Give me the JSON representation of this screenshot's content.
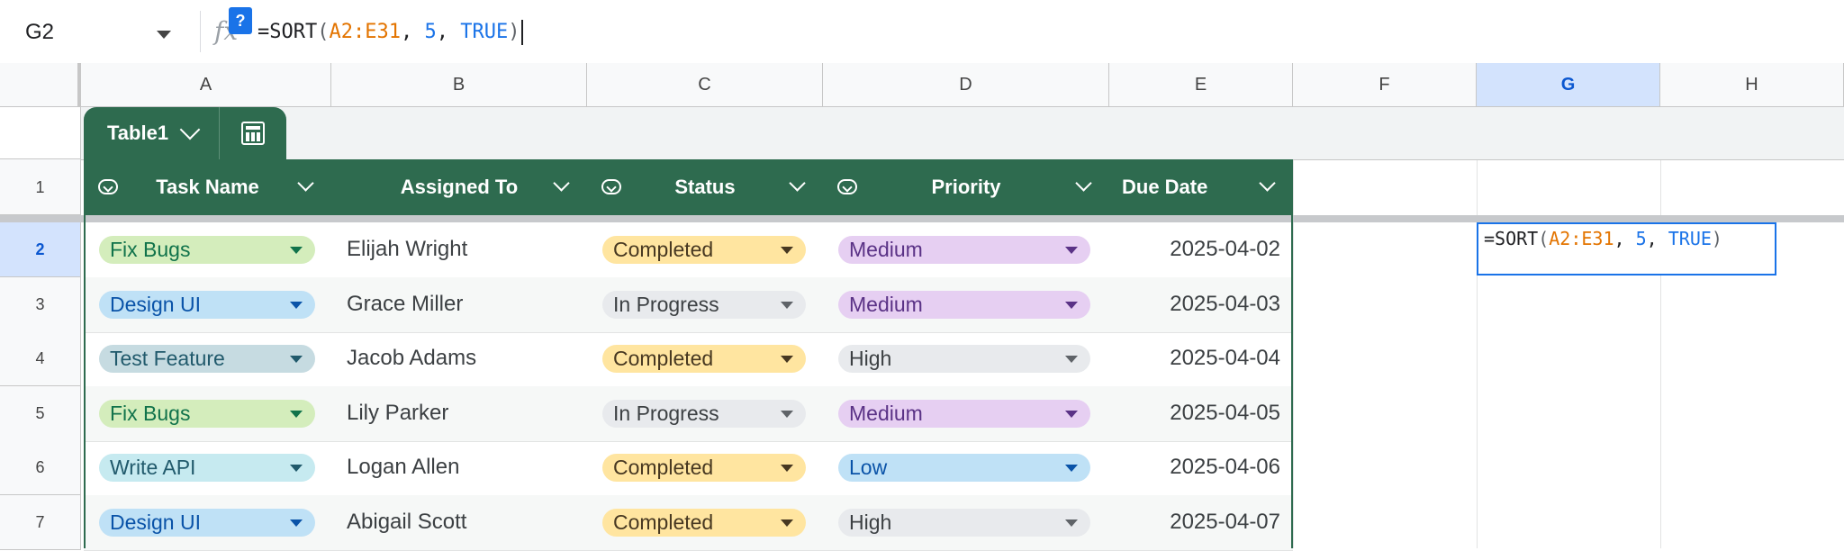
{
  "formula_bar": {
    "name_box": "G2",
    "help": "?",
    "formula": {
      "eq": "=SORT",
      "open": "(",
      "range": "A2:E31",
      "sep1": ", ",
      "num": "5",
      "sep2": ", ",
      "bool": "TRUE",
      "close": ")"
    }
  },
  "columns": [
    "A",
    "B",
    "C",
    "D",
    "E",
    "F",
    "G",
    "H"
  ],
  "selected_column": "G",
  "table": {
    "name": "Table1",
    "headers": [
      "Task Name",
      "Assigned To",
      "Status",
      "Priority",
      "Due Date"
    ],
    "rows": [
      {
        "row": "2",
        "task": "Fix Bugs",
        "task_color": "green",
        "assigned": "Elijah Wright",
        "status": "Completed",
        "status_color": "yellow",
        "priority": "Medium",
        "priority_color": "purple",
        "due": "2025-04-02"
      },
      {
        "row": "3",
        "task": "Design UI",
        "task_color": "blue",
        "assigned": "Grace Miller",
        "status": "In Progress",
        "status_color": "gray",
        "priority": "Medium",
        "priority_color": "purple",
        "due": "2025-04-03"
      },
      {
        "row": "4",
        "task": "Test Feature",
        "task_color": "teal",
        "assigned": "Jacob Adams",
        "status": "Completed",
        "status_color": "yellow",
        "priority": "High",
        "priority_color": "gray",
        "due": "2025-04-04"
      },
      {
        "row": "5",
        "task": "Fix Bugs",
        "task_color": "green",
        "assigned": "Lily Parker",
        "status": "In Progress",
        "status_color": "gray",
        "priority": "Medium",
        "priority_color": "purple",
        "due": "2025-04-05"
      },
      {
        "row": "6",
        "task": "Write API",
        "task_color": "cyan",
        "assigned": "Logan Allen",
        "status": "Completed",
        "status_color": "yellow",
        "priority": "Low",
        "priority_color": "lowblue",
        "due": "2025-04-06"
      },
      {
        "row": "7",
        "task": "Design UI",
        "task_color": "blue",
        "assigned": "Abigail Scott",
        "status": "Completed",
        "status_color": "yellow",
        "priority": "High",
        "priority_color": "gray",
        "due": "2025-04-07"
      }
    ]
  },
  "header_row_number": "1",
  "active_cell_ref": "G2"
}
